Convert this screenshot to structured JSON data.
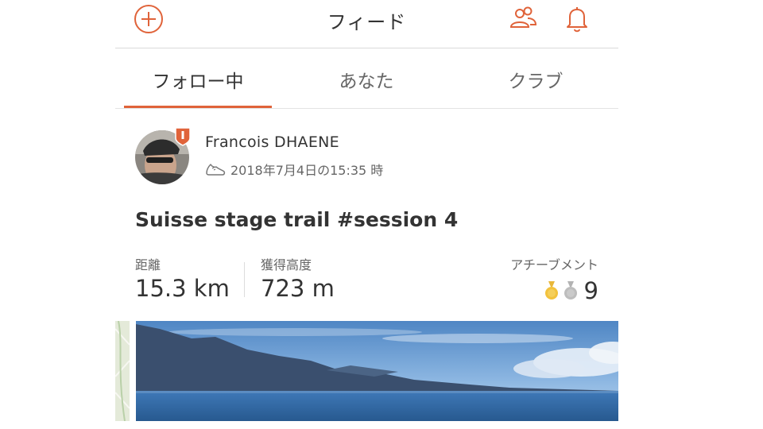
{
  "header": {
    "title": "フィード",
    "icons": {
      "add": "plus-circle-icon",
      "friends": "people-icon",
      "notifications": "bell-icon"
    }
  },
  "tabs": [
    {
      "label": "フォロー中",
      "active": true
    },
    {
      "label": "あなた",
      "active": false
    },
    {
      "label": "クラブ",
      "active": false
    }
  ],
  "post": {
    "author": "Francois DHAENE",
    "timestamp": "2018年7月4日の15:35 時",
    "sport_icon": "shoe-icon",
    "title": "Suisse stage trail #session 4",
    "stats": [
      {
        "label": "距離",
        "value": "15.3 km"
      },
      {
        "label": "獲得高度",
        "value": "723 m"
      }
    ],
    "achievements": {
      "label": "アチーブメント",
      "count": "9",
      "medals": [
        "gold-medal-icon",
        "silver-medal-icon"
      ]
    }
  },
  "colors": {
    "accent": "#e0633a",
    "text": "#333333",
    "muted": "#666666",
    "divider": "#d9d9d9"
  }
}
